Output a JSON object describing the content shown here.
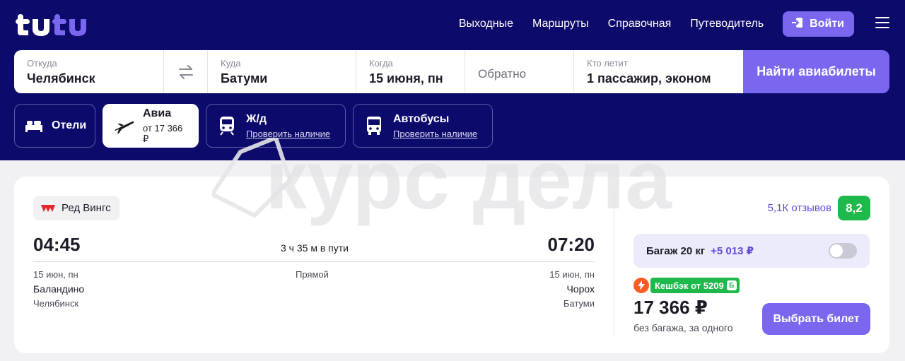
{
  "header": {
    "logo_text": "tutu",
    "nav": [
      "Выходные",
      "Маршруты",
      "Справочная",
      "Путеводитель"
    ],
    "login_label": "Войти"
  },
  "search": {
    "from_label": "Откуда",
    "from_value": "Челябинск",
    "to_label": "Куда",
    "to_value": "Батуми",
    "when_label": "Когда",
    "when_value": "15 июня, пн",
    "return_placeholder": "Обратно",
    "who_label": "Кто летит",
    "who_value": "1 пассажир, эконом",
    "submit_label": "Найти авиабилеты"
  },
  "tabs": [
    {
      "title": "Отели",
      "sub": "",
      "icon": "bed-icon"
    },
    {
      "title": "Авиа",
      "sub": "от 17 366 ₽",
      "icon": "airplane-icon"
    },
    {
      "title": "Ж/д",
      "sub": "Проверить наличие",
      "icon": "train-icon"
    },
    {
      "title": "Автобусы",
      "sub": "Проверить наличие",
      "icon": "bus-icon"
    }
  ],
  "watermark_text": "курс дела",
  "offer": {
    "airline": "Ред Вингс",
    "depart_time": "04:45",
    "arrive_time": "07:20",
    "duration": "3 ч 35 м в пути",
    "stops": "Прямой",
    "depart_date": "15 июн, пн",
    "depart_airport": "Баландино",
    "depart_city": "Челябинск",
    "arrive_date": "15 июн, пн",
    "arrive_airport": "Чорох",
    "arrive_city": "Батуми",
    "reviews": "5,1К отзывов",
    "rating": "8,2",
    "baggage_label": "Багаж 20 кг",
    "baggage_price": "+5 013 ₽",
    "cashback": "Кешбэк от 5209",
    "cashback_badge": "Б",
    "price": "17 366 ₽",
    "price_note": "без багажа, за одного",
    "select_label": "Выбрать билет"
  },
  "colors": {
    "header_bg": "#0c0a6b",
    "accent": "#7a67f0",
    "rating_green": "#1fb84a",
    "bolt_orange": "#ff5a1f"
  }
}
